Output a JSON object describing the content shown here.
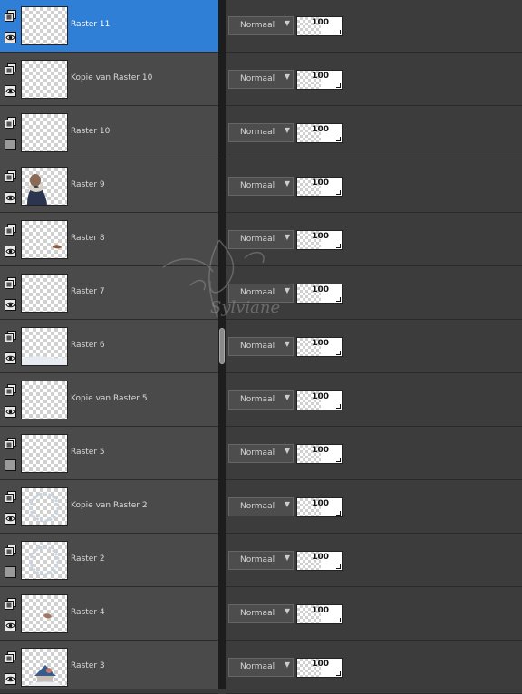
{
  "layers": [
    {
      "name": "Raster 11",
      "selected": true,
      "visible": true,
      "thumb": "empty",
      "blend_mode": "Normaal",
      "opacity": "100"
    },
    {
      "name": "Kopie van Raster 10",
      "selected": false,
      "visible": true,
      "thumb": "empty",
      "blend_mode": "Normaal",
      "opacity": "100"
    },
    {
      "name": "Raster 10",
      "selected": false,
      "visible": false,
      "thumb": "empty",
      "blend_mode": "Normaal",
      "opacity": "100"
    },
    {
      "name": "Raster 9",
      "selected": false,
      "visible": true,
      "thumb": "woman",
      "blend_mode": "Normaal",
      "opacity": "100"
    },
    {
      "name": "Raster 8",
      "selected": false,
      "visible": true,
      "thumb": "bird",
      "blend_mode": "Normaal",
      "opacity": "100"
    },
    {
      "name": "Raster 7",
      "selected": false,
      "visible": true,
      "thumb": "empty",
      "blend_mode": "Normaal",
      "opacity": "100"
    },
    {
      "name": "Raster 6",
      "selected": false,
      "visible": true,
      "thumb": "snow",
      "blend_mode": "Normaal",
      "opacity": "100"
    },
    {
      "name": "Kopie van Raster 5",
      "selected": false,
      "visible": true,
      "thumb": "empty",
      "blend_mode": "Normaal",
      "opacity": "100"
    },
    {
      "name": "Raster 5",
      "selected": false,
      "visible": false,
      "thumb": "empty",
      "blend_mode": "Normaal",
      "opacity": "100"
    },
    {
      "name": "Kopie van Raster 2",
      "selected": false,
      "visible": true,
      "thumb": "ring",
      "blend_mode": "Normaal",
      "opacity": "100"
    },
    {
      "name": "Raster 2",
      "selected": false,
      "visible": false,
      "thumb": "ring",
      "blend_mode": "Normaal",
      "opacity": "100"
    },
    {
      "name": "Raster 4",
      "selected": false,
      "visible": true,
      "thumb": "small-bird",
      "blend_mode": "Normaal",
      "opacity": "100"
    },
    {
      "name": "Raster 3",
      "selected": false,
      "visible": true,
      "thumb": "house",
      "blend_mode": "Normaal",
      "opacity": "100"
    }
  ],
  "watermark": {
    "text": "Sylviane"
  },
  "colors": {
    "selection": "#2f7fd6",
    "panel": "#4a4a4a",
    "right_panel": "#3c3c3c"
  }
}
